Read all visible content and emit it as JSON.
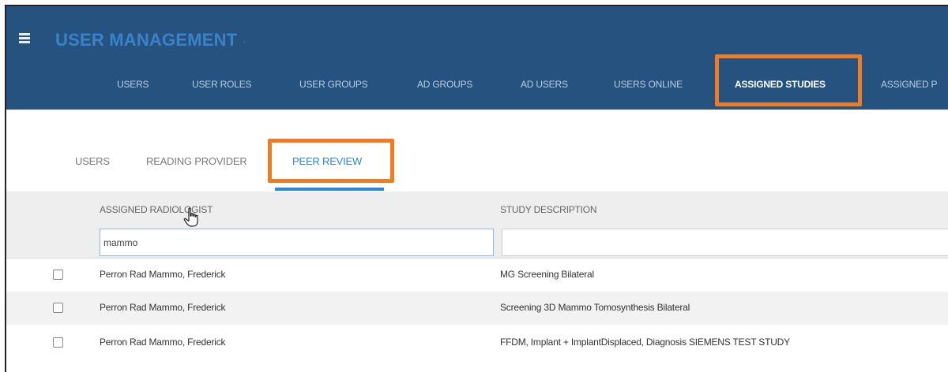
{
  "header": {
    "menu_icon": "hamburger-icon",
    "title": "USER MANAGEMENT",
    "title_suffix": "·",
    "tabs": [
      {
        "label": "USERS"
      },
      {
        "label": "USER ROLES"
      },
      {
        "label": "USER GROUPS"
      },
      {
        "label": "AD GROUPS"
      },
      {
        "label": "AD USERS"
      },
      {
        "label": "USERS ONLINE"
      },
      {
        "label": "ASSIGNED STUDIES",
        "active": true
      },
      {
        "label": "ASSIGNED P"
      }
    ]
  },
  "sub_tabs": [
    {
      "label": "USERS"
    },
    {
      "label": "READING PROVIDER"
    },
    {
      "label": "PEER REVIEW",
      "active": true
    }
  ],
  "grid": {
    "columns": [
      "ASSIGNED RADIOLOGIST",
      "STUDY DESCRIPTION"
    ],
    "filters": {
      "radiologist_value": "mammo",
      "study_value": ""
    },
    "rows": [
      {
        "radiologist": "Perron Rad Mammo, Frederick",
        "study": "MG Screening Bilateral",
        "checked": false
      },
      {
        "radiologist": "Perron Rad Mammo, Frederick",
        "study": "Screening 3D Mammo Tomosynthesis Bilateral",
        "checked": false
      },
      {
        "radiologist": "Perron Rad Mammo, Frederick",
        "study": "FFDM, Implant + ImplantDisplaced, Diagnosis SIEMENS TEST STUDY",
        "checked": false
      }
    ]
  },
  "colors": {
    "header_bg": "#25527f",
    "highlight": "#f07b22",
    "accent": "#2f86d6"
  }
}
